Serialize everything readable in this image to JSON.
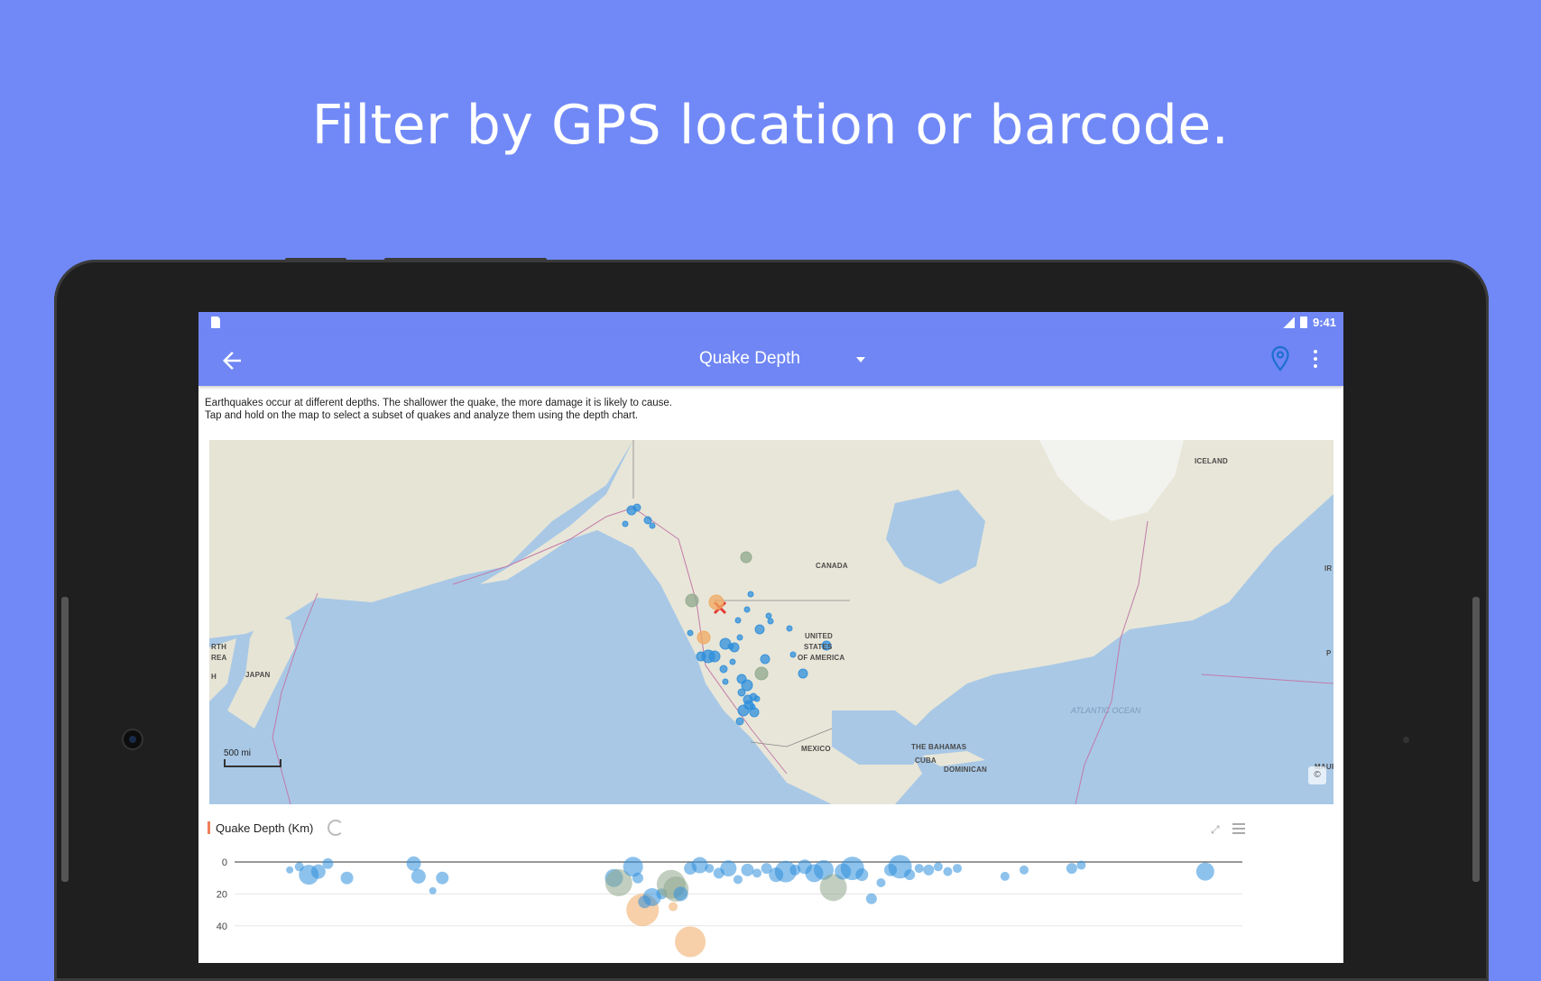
{
  "headline": "Filter by GPS location or barcode.",
  "status_bar": {
    "time": "9:41",
    "icons": [
      "sd-card-icon",
      "lte-signal-icon",
      "battery-icon"
    ]
  },
  "toolbar": {
    "back_icon": "back-arrow-icon",
    "title": "Quake Depth",
    "location_icon": "location-pin-icon",
    "more_icon": "more-vert-icon"
  },
  "description": {
    "line1": "Earthquakes occur at different depths. The shallower the quake, the more damage it is likely to cause.",
    "line2": "Tap and hold on the map to select a subset of quakes and analyze them using the depth chart."
  },
  "map": {
    "scale": "500 mi",
    "attribution": "©",
    "labels": {
      "canada": "CANADA",
      "usa1": "UNITED",
      "usa2": "STATES",
      "usa3": "OF AMERICA",
      "mexico": "MEXICO",
      "japan": "JAPAN",
      "iceland": "ICELAND",
      "bahamas": "THE BAHAMAS",
      "cuba": "CUBA",
      "dominican": "DOMINICAN",
      "atlantic": "ATLANTIC OCEAN",
      "north": "RTH",
      "korea": "REA",
      "h": "H",
      "ir": "IR",
      "p": "P",
      "maur": "MAUR"
    },
    "colors": {
      "water": "#a9c9e6",
      "land": "#e8e6d9",
      "quake_shallow": "#2f8fdc",
      "quake_mid": "#8fa88c",
      "quake_deep": "#f0a860",
      "selection": "#e53935"
    }
  },
  "chart": {
    "title": "Quake Depth (Km)",
    "icons": [
      "refresh-icon",
      "expand-icon",
      "list-icon"
    ]
  },
  "chart_data": {
    "type": "scatter",
    "title": "Quake Depth (Km)",
    "xlabel": "",
    "ylabel": "",
    "y_ticks": [
      "0",
      "20",
      "40"
    ],
    "ylim": [
      0,
      55
    ],
    "y_inverted": true,
    "points": [
      {
        "x": 2,
        "y": 5,
        "r": 4
      },
      {
        "x": 3,
        "y": 3,
        "r": 5
      },
      {
        "x": 4,
        "y": 8,
        "r": 11
      },
      {
        "x": 5,
        "y": 6,
        "r": 8
      },
      {
        "x": 6,
        "y": 1,
        "r": 6
      },
      {
        "x": 8,
        "y": 10,
        "r": 7
      },
      {
        "x": 15,
        "y": 1,
        "r": 8
      },
      {
        "x": 15.5,
        "y": 9,
        "r": 8
      },
      {
        "x": 17,
        "y": 18,
        "r": 4
      },
      {
        "x": 18,
        "y": 10,
        "r": 7
      },
      {
        "x": 36,
        "y": 10,
        "r": 10
      },
      {
        "x": 36.5,
        "y": 13,
        "r": 15
      },
      {
        "x": 38,
        "y": 3,
        "r": 11
      },
      {
        "x": 38.5,
        "y": 10,
        "r": 6
      },
      {
        "x": 39,
        "y": 30,
        "r": 18
      },
      {
        "x": 39.2,
        "y": 25,
        "r": 7
      },
      {
        "x": 40,
        "y": 22,
        "r": 10
      },
      {
        "x": 41,
        "y": 20,
        "r": 6
      },
      {
        "x": 42,
        "y": 14,
        "r": 16
      },
      {
        "x": 42.5,
        "y": 17,
        "r": 14
      },
      {
        "x": 43,
        "y": 20,
        "r": 8
      },
      {
        "x": 42.2,
        "y": 28,
        "r": 5
      },
      {
        "x": 44,
        "y": 50,
        "r": 17
      },
      {
        "x": 44,
        "y": 4,
        "r": 7
      },
      {
        "x": 45,
        "y": 2,
        "r": 9
      },
      {
        "x": 46,
        "y": 4,
        "r": 5
      },
      {
        "x": 47,
        "y": 7,
        "r": 6
      },
      {
        "x": 48,
        "y": 4,
        "r": 9
      },
      {
        "x": 49,
        "y": 11,
        "r": 5
      },
      {
        "x": 50,
        "y": 5,
        "r": 7
      },
      {
        "x": 51,
        "y": 7,
        "r": 5
      },
      {
        "x": 52,
        "y": 4,
        "r": 6
      },
      {
        "x": 53,
        "y": 8,
        "r": 8
      },
      {
        "x": 54,
        "y": 6,
        "r": 12
      },
      {
        "x": 55,
        "y": 5,
        "r": 6
      },
      {
        "x": 56,
        "y": 3,
        "r": 8
      },
      {
        "x": 57,
        "y": 7,
        "r": 10
      },
      {
        "x": 58,
        "y": 5,
        "r": 11
      },
      {
        "x": 59,
        "y": 16,
        "r": 15
      },
      {
        "x": 60,
        "y": 6,
        "r": 9
      },
      {
        "x": 61,
        "y": 4,
        "r": 13
      },
      {
        "x": 62,
        "y": 8,
        "r": 7
      },
      {
        "x": 63,
        "y": 23,
        "r": 6
      },
      {
        "x": 64,
        "y": 13,
        "r": 5
      },
      {
        "x": 65,
        "y": 5,
        "r": 7
      },
      {
        "x": 66,
        "y": 3,
        "r": 13
      },
      {
        "x": 67,
        "y": 8,
        "r": 6
      },
      {
        "x": 68,
        "y": 4,
        "r": 5
      },
      {
        "x": 69,
        "y": 5,
        "r": 6
      },
      {
        "x": 70,
        "y": 3,
        "r": 5
      },
      {
        "x": 71,
        "y": 6,
        "r": 5
      },
      {
        "x": 72,
        "y": 4,
        "r": 5
      },
      {
        "x": 77,
        "y": 9,
        "r": 5
      },
      {
        "x": 79,
        "y": 5,
        "r": 5
      },
      {
        "x": 84,
        "y": 4,
        "r": 6
      },
      {
        "x": 85,
        "y": 2,
        "r": 5
      },
      {
        "x": 98,
        "y": 6,
        "r": 10
      }
    ],
    "series_colors": {
      "shallow": "#2f8fdc",
      "mid": "#8fa88c",
      "deep": "#f0a860"
    }
  }
}
